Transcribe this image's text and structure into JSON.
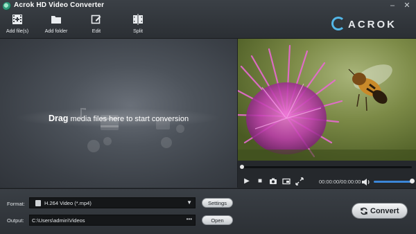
{
  "window": {
    "title": "Acrok HD Video Converter",
    "minimize": "–",
    "close": "✕"
  },
  "toolbar": {
    "add_files": "Add file(s)",
    "add_folder": "Add folder",
    "edit": "Edit",
    "split": "Split"
  },
  "brand": {
    "name": "ACROK",
    "accent": "#53b7e8"
  },
  "drop_area": {
    "lead": "Drag",
    "message": " media files here to start conversion"
  },
  "player": {
    "timecode": "00:00:00/00:00:00",
    "seek_position": 0,
    "volume": 1.0
  },
  "format": {
    "label": "Format:",
    "selected": "H.264 Video (*.mp4)",
    "settings_button": "Settings"
  },
  "output": {
    "label": "Output:",
    "path": "C:\\Users\\admin\\Videos",
    "browse_icon": "•••",
    "open_button": "Open"
  },
  "convert_button": "Convert"
}
